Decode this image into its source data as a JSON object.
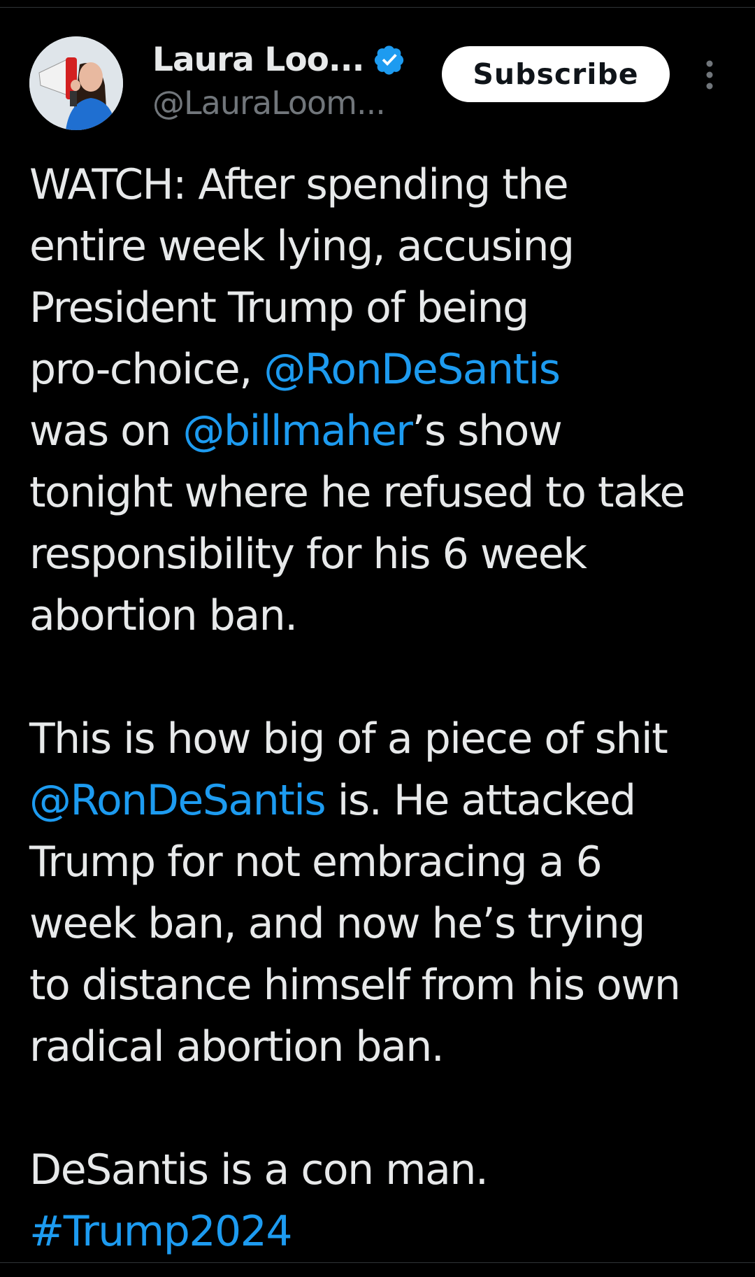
{
  "author": {
    "display_name": "Laura Loo...",
    "handle": "@LauraLoom...",
    "verified": true
  },
  "actions": {
    "subscribe_label": "Subscribe"
  },
  "colors": {
    "background": "#000000",
    "text": "#e7e9ea",
    "muted": "#71767b",
    "link": "#1d9bf0",
    "verified_badge": "#1d9bf0"
  },
  "icons": {
    "verified": "verified-badge-icon",
    "more": "more-vertical-icon",
    "avatar": "avatar-megaphone"
  },
  "tweet": {
    "p1": {
      "t1": "WATCH: After spending the",
      "t2": "entire week lying, accusing",
      "t3": "President Trump of being",
      "t4a": "pro-choice, ",
      "m1": "@RonDeSantis",
      "t5a": "was on ",
      "m2": "@billmaher",
      "t5b": "’s show",
      "t6": "tonight where he refused to take",
      "t7": "responsibility for his 6 week",
      "t8": "abortion ban."
    },
    "p2": {
      "t1": "This is how big of a piece of shit",
      "m1": "@RonDeSantis",
      "t2b": " is. He attacked",
      "t3": "Trump for not embracing a 6",
      "t4": "week ban, and now he’s trying",
      "t5": "to distance himself from his own",
      "t6": "radical abortion ban."
    },
    "p3": {
      "t1": "DeSantis is a con man.",
      "hashtag": "#Trump2024"
    }
  }
}
